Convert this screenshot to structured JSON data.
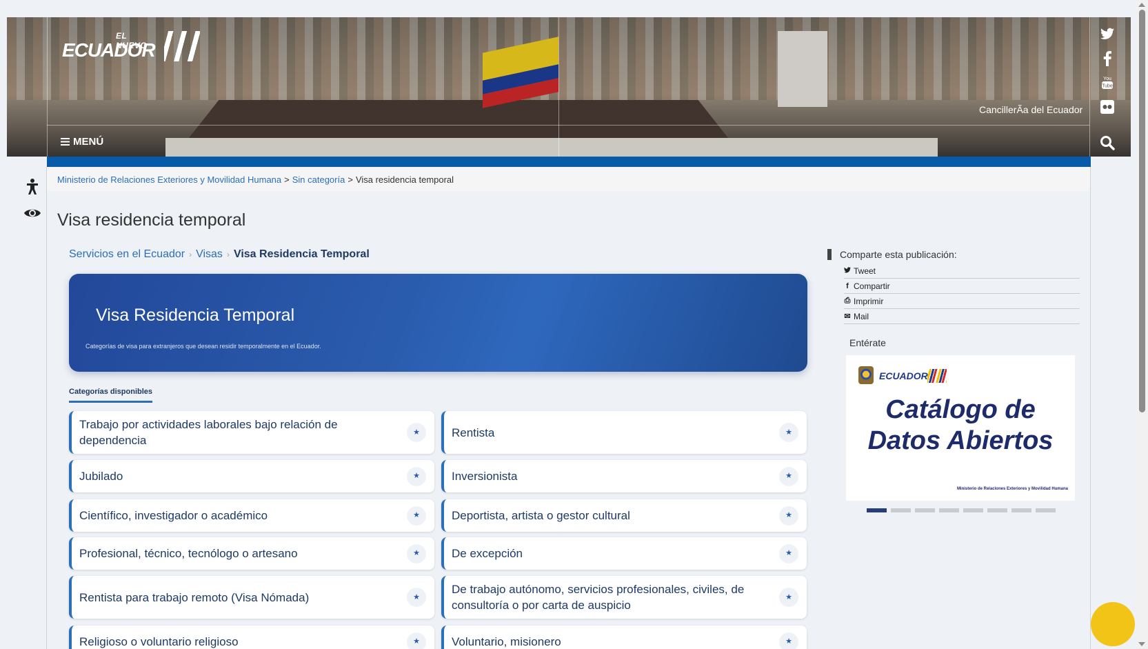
{
  "header": {
    "logo_small": "EL NUEVO",
    "logo_big": "ECUADOR",
    "menu_label": "MENÚ",
    "site_name": "CancillerÃa del Ecuador",
    "social_icons": [
      "twitter-icon",
      "facebook-icon",
      "youtube-icon",
      "flickr-icon"
    ],
    "youtube_text": "You Tube"
  },
  "breadcrumb": {
    "items": [
      "Ministerio de Relaciones Exteriores y Movilidad Humana",
      "Sin categoría"
    ],
    "current": "Visa residencia temporal",
    "separator": ">"
  },
  "page_title": "Visa residencia temporal",
  "sub_breadcrumb": {
    "items": [
      "Servicios en el Ecuador",
      "Visas"
    ],
    "current": "Visa Residencia Temporal",
    "separator": "›"
  },
  "hero": {
    "title": "Visa Residencia Temporal",
    "description": "Categorías de visa para extranjeros que desean residir temporalmente en el Ecuador."
  },
  "categories_tab": "Categorías disponibles",
  "categories": [
    "Trabajo por actividades laborales bajo relación de dependencia",
    "Rentista",
    "Jubilado",
    "Inversionista",
    "Científico, investigador o académico",
    "Deportista, artista o gestor cultural",
    "Profesional, técnico, tecnólogo o artesano",
    "De excepción",
    "Rentista para trabajo remoto (Visa Nómada)",
    "De trabajo autónomo, servicios profesionales, civiles, de consultoría o por carta de auspicio",
    "Religioso o voluntario religioso",
    "Voluntario, misionero"
  ],
  "card_star": "★",
  "share": {
    "heading": "Comparte esta publicación:",
    "items": [
      {
        "icon": "twitter-icon",
        "glyph": "🐦",
        "label": "Tweet"
      },
      {
        "icon": "facebook-icon",
        "glyph": "f",
        "label": "Compartir"
      },
      {
        "icon": "print-icon",
        "glyph": "⎙",
        "label": "Imprimir"
      },
      {
        "icon": "mail-icon",
        "glyph": "✉",
        "label": "Mail"
      }
    ]
  },
  "enterate": {
    "heading": "Entérate",
    "slide": {
      "logo_text": "ECUADOR",
      "line1": "Catálogo de",
      "line2": "Datos Abiertos",
      "footer": "Ministerio de Relaciones Exteriores y Movilidad Humana"
    },
    "dots_active": 0
  },
  "colors": {
    "accent": "#2a6fb8",
    "nav_bar": "#075aa8",
    "dark_text": "#1e3a63",
    "chat_button": "#f2c418"
  }
}
